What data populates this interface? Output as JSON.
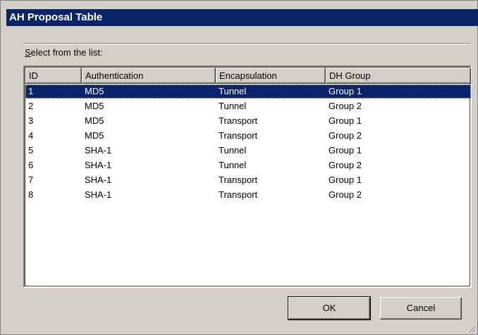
{
  "window": {
    "title": "AH Proposal Table"
  },
  "list": {
    "instruction_prefix": "S",
    "instruction_rest": "elect from the list:",
    "columns": [
      "ID",
      "Authentication",
      "Encapsulation",
      "DH Group"
    ],
    "selected_index": 0,
    "rows": [
      [
        "1",
        "MD5",
        "Tunnel",
        "Group 1"
      ],
      [
        "2",
        "MD5",
        "Tunnel",
        "Group 2"
      ],
      [
        "3",
        "MD5",
        "Transport",
        "Group 1"
      ],
      [
        "4",
        "MD5",
        "Transport",
        "Group 2"
      ],
      [
        "5",
        "SHA-1",
        "Tunnel",
        "Group 1"
      ],
      [
        "6",
        "SHA-1",
        "Tunnel",
        "Group 2"
      ],
      [
        "7",
        "SHA-1",
        "Transport",
        "Group 1"
      ],
      [
        "8",
        "SHA-1",
        "Transport",
        "Group 2"
      ]
    ]
  },
  "buttons": {
    "ok_label": "OK",
    "cancel_label": "Cancel"
  },
  "colors": {
    "titlebar": "#0a246a",
    "selection": "#0a246a",
    "face": "#d4d0c8"
  }
}
